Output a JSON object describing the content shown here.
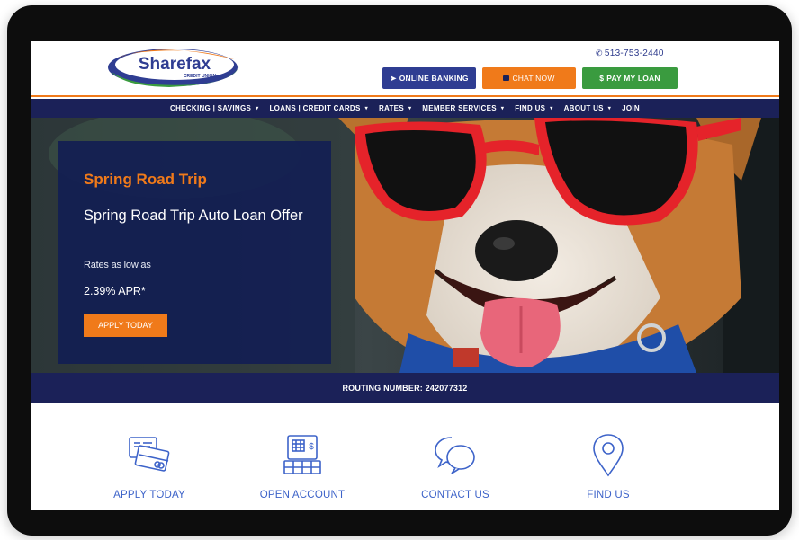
{
  "header": {
    "logo_name": "Sharefax",
    "logo_sub": "CREDIT UNION",
    "phone": "513-753-2440",
    "buttons": {
      "online_banking": "ONLINE BANKING",
      "chat_now": "CHAT NOW",
      "pay_my_loan": "PAY MY LOAN"
    }
  },
  "nav": {
    "items": [
      {
        "label": "CHECKING | SAVINGS",
        "caret": "▾"
      },
      {
        "label": "LOANS | CREDIT CARDS",
        "caret": "▾"
      },
      {
        "label": "RATES",
        "caret": "▾"
      },
      {
        "label": "MEMBER SERVICES",
        "caret": "▾"
      },
      {
        "label": "FIND US",
        "caret": "▾"
      },
      {
        "label": "ABOUT US",
        "caret": "▾"
      },
      {
        "label": "JOIN",
        "caret": ""
      }
    ]
  },
  "hero": {
    "title": "Spring Road Trip",
    "subtitle": "Spring Road Trip Auto Loan Offer",
    "rates_text": "Rates as low as",
    "apr": "2.39% APR*",
    "cta": "APPLY TODAY"
  },
  "routing": {
    "text": "ROUTING NUMBER: 242077312"
  },
  "quick_links": [
    {
      "label": "APPLY TODAY",
      "icon": "credit-cards-icon"
    },
    {
      "label": "OPEN ACCOUNT",
      "icon": "computer-dollar-icon"
    },
    {
      "label": "CONTACT US",
      "icon": "speech-bubbles-icon"
    },
    {
      "label": "FIND US",
      "icon": "location-pin-icon"
    }
  ],
  "colors": {
    "navy": "#1b2158",
    "orange": "#f07a1a",
    "green": "#3a9b3f",
    "blue_button": "#2f3d92",
    "link_blue": "#3d63c9"
  }
}
